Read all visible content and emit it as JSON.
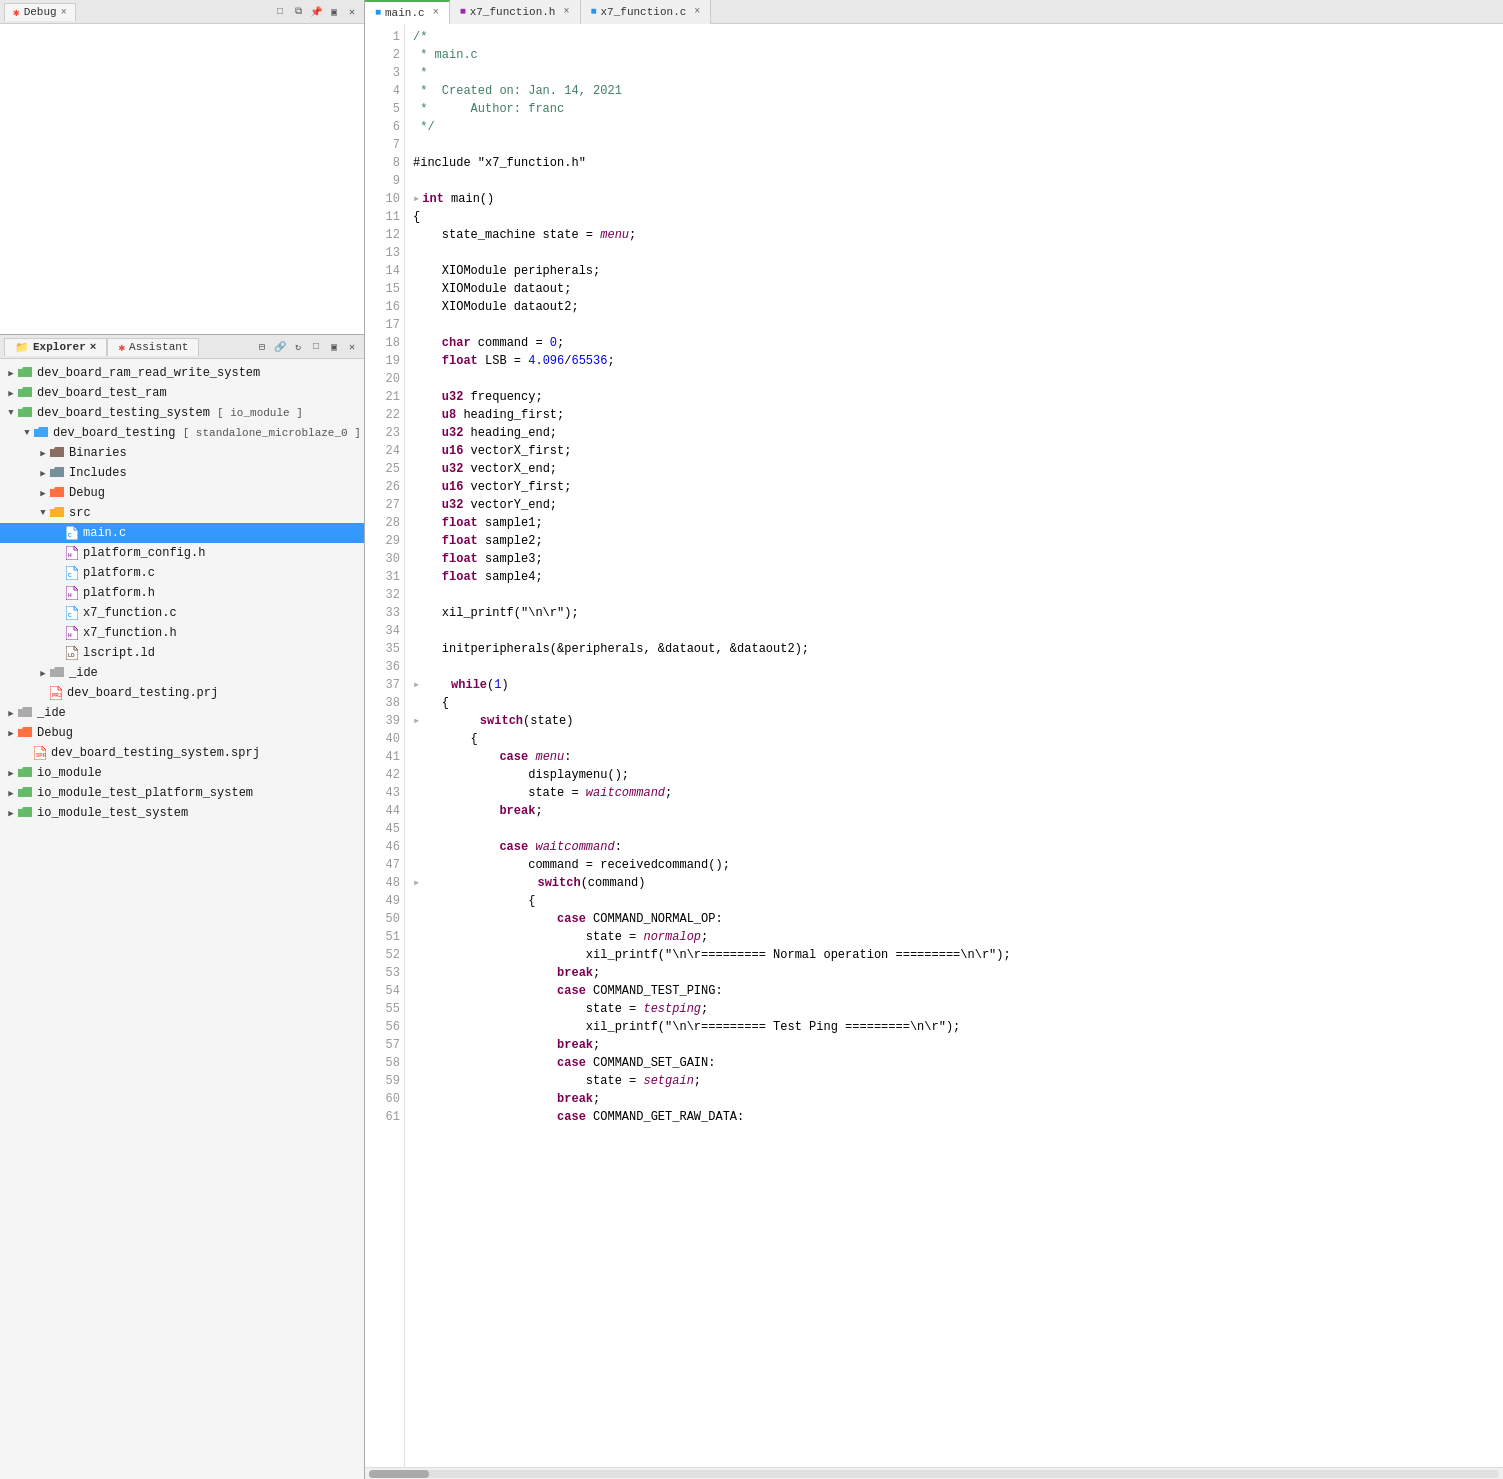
{
  "leftPanel": {
    "debugTab": {
      "label": "Debug",
      "closeIcon": "×"
    },
    "explorerTab": {
      "label": "Explorer",
      "closeIcon": "×"
    },
    "assistantTab": {
      "label": "Assistant"
    },
    "tree": [
      {
        "id": "dev_board_ram_read_write_system",
        "level": 0,
        "label": "dev_board_ram_read_write_system",
        "type": "folder-green",
        "expanded": false,
        "arrow": "▶"
      },
      {
        "id": "dev_board_test_ram",
        "level": 0,
        "label": "dev_board_test_ram",
        "type": "folder-green",
        "expanded": false,
        "arrow": "▶"
      },
      {
        "id": "dev_board_testing_system",
        "level": 0,
        "label": "dev_board_testing_system",
        "suffix": "[ io_module ]",
        "type": "folder-green",
        "expanded": true,
        "arrow": "▼"
      },
      {
        "id": "dev_board_testing",
        "level": 1,
        "label": "dev_board_testing",
        "suffix": "[ standalone_microblaze_0 ]",
        "type": "folder-blue",
        "expanded": true,
        "arrow": "▼"
      },
      {
        "id": "Binaries",
        "level": 2,
        "label": "Binaries",
        "type": "folder-binaries",
        "expanded": false,
        "arrow": "▶"
      },
      {
        "id": "Includes",
        "level": 2,
        "label": "Includes",
        "type": "folder-includes",
        "expanded": false,
        "arrow": "▶"
      },
      {
        "id": "Debug",
        "level": 2,
        "label": "Debug",
        "type": "folder-debug",
        "expanded": false,
        "arrow": "▶"
      },
      {
        "id": "src",
        "level": 2,
        "label": "src",
        "type": "folder-yellow",
        "expanded": true,
        "arrow": "▼"
      },
      {
        "id": "main_c",
        "level": 3,
        "label": "main.c",
        "type": "file-c",
        "selected": true
      },
      {
        "id": "platform_config_h",
        "level": 3,
        "label": "platform_config.h",
        "type": "file-h"
      },
      {
        "id": "platform_c",
        "level": 3,
        "label": "platform.c",
        "type": "file-c"
      },
      {
        "id": "platform_h",
        "level": 3,
        "label": "platform.h",
        "type": "file-h"
      },
      {
        "id": "x7_function_c",
        "level": 3,
        "label": "x7_function.c",
        "type": "file-c"
      },
      {
        "id": "x7_function_h",
        "level": 3,
        "label": "x7_function.h",
        "type": "file-h"
      },
      {
        "id": "lscript_ld",
        "level": 3,
        "label": "lscript.ld",
        "type": "file-ld"
      },
      {
        "id": "_ide",
        "level": 2,
        "label": "_ide",
        "type": "folder-gray",
        "expanded": false,
        "arrow": "▶"
      },
      {
        "id": "dev_board_testing_prj",
        "level": 2,
        "label": "dev_board_testing.prj",
        "type": "file-prj"
      },
      {
        "id": "_ide2",
        "level": 0,
        "label": "_ide",
        "type": "folder-gray",
        "expanded": false,
        "arrow": "▶"
      },
      {
        "id": "Debug2",
        "level": 0,
        "label": "Debug",
        "type": "folder-debug",
        "expanded": false,
        "arrow": "▶"
      },
      {
        "id": "dev_board_testing_system_sprj",
        "level": 1,
        "label": "dev_board_testing_system.sprj",
        "type": "file-sprj"
      },
      {
        "id": "io_module",
        "level": 0,
        "label": "io_module",
        "type": "folder-green",
        "expanded": false,
        "arrow": "▶"
      },
      {
        "id": "io_module_test_platform_system",
        "level": 0,
        "label": "io_module_test_platform_system",
        "type": "folder-green",
        "expanded": false,
        "arrow": "▶"
      },
      {
        "id": "io_module_test_system",
        "level": 0,
        "label": "io_module_test_system",
        "type": "folder-green",
        "expanded": false,
        "arrow": "▶"
      }
    ]
  },
  "editor": {
    "tabs": [
      {
        "id": "main_c",
        "label": "main.c",
        "active": true,
        "icon": "c-file"
      },
      {
        "id": "x7_function_h",
        "label": "x7_function.h",
        "active": false,
        "icon": "h-file"
      },
      {
        "id": "x7_function_c",
        "label": "x7_function.c",
        "active": false,
        "icon": "c-file"
      }
    ],
    "lines": [
      {
        "num": 1,
        "code": "/*"
      },
      {
        "num": 2,
        "code": " * main.c"
      },
      {
        "num": 3,
        "code": " *"
      },
      {
        "num": 4,
        "code": " *  Created on: Jan. 14, 2021"
      },
      {
        "num": 5,
        "code": " *      Author: franc"
      },
      {
        "num": 6,
        "code": " */"
      },
      {
        "num": 7,
        "code": ""
      },
      {
        "num": 8,
        "code": "#include \"x7_function.h\""
      },
      {
        "num": 9,
        "code": ""
      },
      {
        "num": 10,
        "code": "int main()"
      },
      {
        "num": 11,
        "code": "{"
      },
      {
        "num": 12,
        "code": "    state_machine state = menu;"
      },
      {
        "num": 13,
        "code": ""
      },
      {
        "num": 14,
        "code": "    XIOModule peripherals;"
      },
      {
        "num": 15,
        "code": "    XIOModule dataout;"
      },
      {
        "num": 16,
        "code": "    XIOModule dataout2;"
      },
      {
        "num": 17,
        "code": ""
      },
      {
        "num": 18,
        "code": "    char command = 0;"
      },
      {
        "num": 19,
        "code": "    float LSB = 4.096/65536;"
      },
      {
        "num": 20,
        "code": ""
      },
      {
        "num": 21,
        "code": "    u32 frequency;"
      },
      {
        "num": 22,
        "code": "    u8 heading_first;"
      },
      {
        "num": 23,
        "code": "    u32 heading_end;"
      },
      {
        "num": 24,
        "code": "    u16 vectorX_first;"
      },
      {
        "num": 25,
        "code": "    u32 vectorX_end;"
      },
      {
        "num": 26,
        "code": "    u16 vectorY_first;"
      },
      {
        "num": 27,
        "code": "    u32 vectorY_end;"
      },
      {
        "num": 28,
        "code": "    float sample1;"
      },
      {
        "num": 29,
        "code": "    float sample2;"
      },
      {
        "num": 30,
        "code": "    float sample3;"
      },
      {
        "num": 31,
        "code": "    float sample4;"
      },
      {
        "num": 32,
        "code": ""
      },
      {
        "num": 33,
        "code": "    xil_printf(\"\\n\\r\");"
      },
      {
        "num": 34,
        "code": ""
      },
      {
        "num": 35,
        "code": "    initperipherals(&peripherals, &dataout, &dataout2);"
      },
      {
        "num": 36,
        "code": ""
      },
      {
        "num": 37,
        "code": "    while(1)"
      },
      {
        "num": 38,
        "code": "    {"
      },
      {
        "num": 39,
        "code": "        switch(state)"
      },
      {
        "num": 40,
        "code": "        {"
      },
      {
        "num": 41,
        "code": "            case menu:"
      },
      {
        "num": 42,
        "code": "                displaymenu();"
      },
      {
        "num": 43,
        "code": "                state = waitcommand;"
      },
      {
        "num": 44,
        "code": "            break;"
      },
      {
        "num": 45,
        "code": ""
      },
      {
        "num": 46,
        "code": "            case waitcommand:"
      },
      {
        "num": 47,
        "code": "                command = receivedcommand();"
      },
      {
        "num": 48,
        "code": "                switch(command)"
      },
      {
        "num": 49,
        "code": "                {"
      },
      {
        "num": 50,
        "code": "                    case COMMAND_NORMAL_OP:"
      },
      {
        "num": 51,
        "code": "                        state = normalop;"
      },
      {
        "num": 52,
        "code": "                        xil_printf(\"\\n\\r========= Normal operation =========\\n\\r\");"
      },
      {
        "num": 53,
        "code": "                    break;"
      },
      {
        "num": 54,
        "code": "                    case COMMAND_TEST_PING:"
      },
      {
        "num": 55,
        "code": "                        state = testping;"
      },
      {
        "num": 56,
        "code": "                        xil_printf(\"\\n\\r========= Test Ping =========\\n\\r\");"
      },
      {
        "num": 57,
        "code": "                    break;"
      },
      {
        "num": 58,
        "code": "                    case COMMAND_SET_GAIN:"
      },
      {
        "num": 59,
        "code": "                        state = setgain;"
      },
      {
        "num": 60,
        "code": "                    break;"
      },
      {
        "num": 61,
        "code": "                    case COMMAND_GET_RAW_DATA:"
      }
    ]
  }
}
